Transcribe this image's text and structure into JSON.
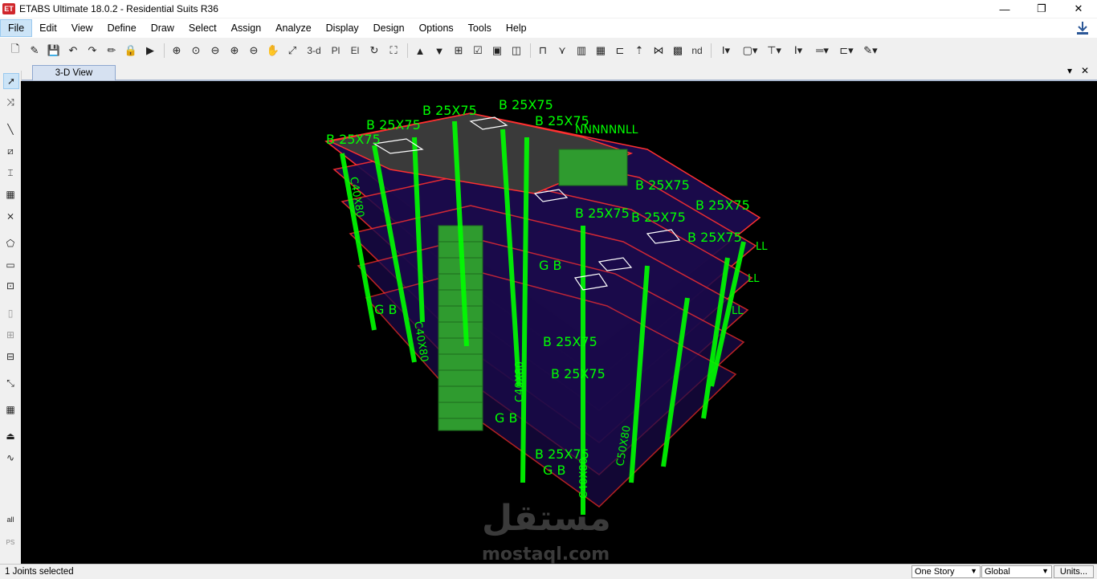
{
  "window": {
    "logo_text": "ET",
    "title": "ETABS Ultimate 18.0.2 - Residential Suits R36",
    "minimize": "—",
    "restore": "❐",
    "close": "✕"
  },
  "menu": {
    "items": [
      {
        "label": "File"
      },
      {
        "label": "Edit"
      },
      {
        "label": "View"
      },
      {
        "label": "Define"
      },
      {
        "label": "Draw"
      },
      {
        "label": "Select"
      },
      {
        "label": "Assign"
      },
      {
        "label": "Analyze"
      },
      {
        "label": "Display"
      },
      {
        "label": "Design"
      },
      {
        "label": "Options"
      },
      {
        "label": "Tools"
      },
      {
        "label": "Help"
      }
    ],
    "active": "File"
  },
  "toolbar": {
    "view_3d_label": "3-d",
    "plan_label": "Pl",
    "elev_label": "El",
    "nd_label": "nd"
  },
  "tab": {
    "label": "3-D View",
    "dropdown_icon": "▾",
    "close_icon": "✕"
  },
  "left_tools": {
    "all_label": "all",
    "ps_label": "PS"
  },
  "model_labels": {
    "beam_a": "B 25X75",
    "beam_b": "B 25X75",
    "beam_c": "B 25X75",
    "beam_d": "B 25X75",
    "beam_e": "B 25X75",
    "beam_f": "B 25X75",
    "beam_g": "B 25X75",
    "beam_h": "B 25X75",
    "beam_i": "B 25X75",
    "beam_j": "B 25X75",
    "beam_k": "B 25X75",
    "beam_l": "B 25X75",
    "beam_m": "B 25X75",
    "gb_a": "G B",
    "gb_b": "G B",
    "gb_c": "G B",
    "gb_d": "G B",
    "col_a": "C40X80",
    "col_b": "C40X80",
    "col_c": "C40X80",
    "col_d": "C50X80",
    "col_e": "C40X80",
    "wall_a": "NNNNNNLL",
    "wall_b": "LL",
    "wall_c": "LL",
    "wall_d": "LL"
  },
  "watermark": {
    "arabic": "مستقل",
    "latin": "mostaql.com"
  },
  "status": {
    "message": "1 Joints selected",
    "story_option": "One Story",
    "coord_option": "Global",
    "units_label": "Units..."
  },
  "colors": {
    "viewport_bg": "#000000",
    "frame_label": "#00ff00",
    "slab": "#1a0a4a",
    "beam": "#ff3030",
    "wall": "#2f9b2f"
  }
}
